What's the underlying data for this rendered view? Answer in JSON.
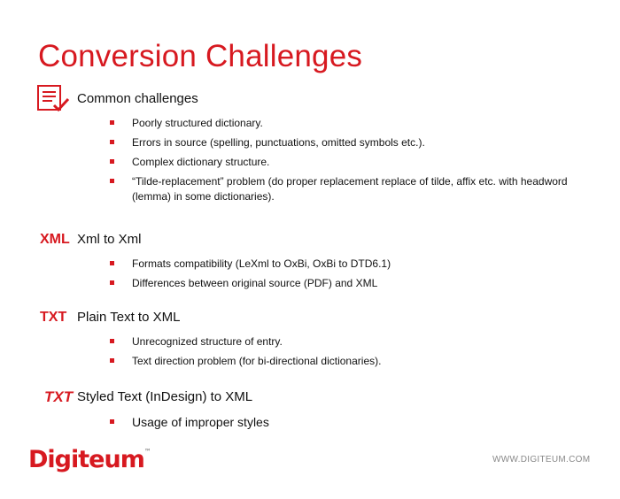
{
  "title": "Conversion Challenges",
  "colors": {
    "accent": "#d71920",
    "text": "#111111",
    "muted": "#888888"
  },
  "sections": [
    {
      "icon": "checklist-icon",
      "label": "Common challenges",
      "items": [
        "Poorly structured dictionary.",
        "Errors in source (spelling, punctuations, omitted symbols etc.).",
        "Complex dictionary structure.",
        "“Tilde-replacement” problem (do proper replacement replace of tilde, affix etc. with headword (lemma) in some dictionaries)."
      ]
    },
    {
      "tag": "XML",
      "label": "Xml to Xml",
      "items": [
        "Formats compatibility (LeXml to OxBi, OxBi to DTD6.1)",
        "Differences between original source (PDF) and XML"
      ]
    },
    {
      "tag": "TXT",
      "label": "Plain Text to XML",
      "items": [
        "Unrecognized structure of entry.",
        "Text direction problem (for bi-directional dictionaries)."
      ]
    },
    {
      "tag": "TXT",
      "label": "Styled Text (InDesign) to XML",
      "items": [
        "Usage of improper styles"
      ]
    }
  ],
  "footer": {
    "logo": "Digiteum",
    "logo_mark": "™",
    "url": "WWW.DIGITEUM.COM"
  }
}
